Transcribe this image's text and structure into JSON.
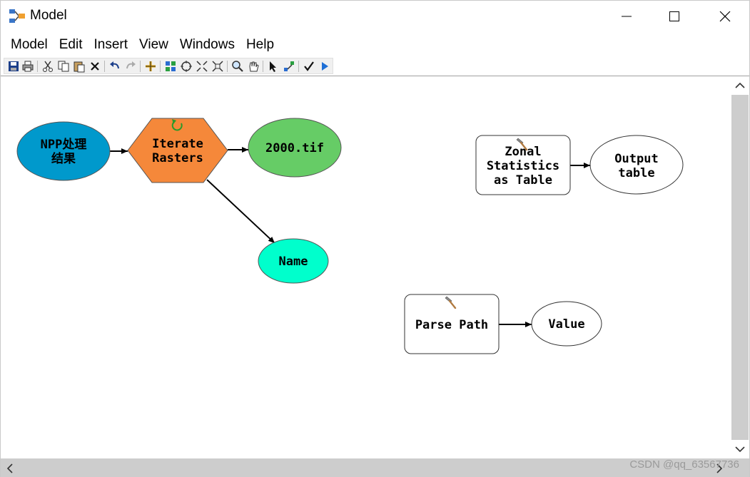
{
  "window": {
    "title": "Model",
    "controls": {
      "minimize": "minimize-icon",
      "maximize": "maximize-icon",
      "close": "close-icon"
    }
  },
  "menu": [
    "Model",
    "Edit",
    "Insert",
    "View",
    "Windows",
    "Help"
  ],
  "toolbar": {
    "buttons": [
      "save-icon",
      "print-icon",
      "cut-icon",
      "copy-icon",
      "paste-icon",
      "delete-icon",
      "undo-icon",
      "redo-icon",
      "add-data-icon",
      "auto-layout-icon",
      "full-extent-icon",
      "zoom-in-fixed-icon",
      "zoom-out-fixed-icon",
      "zoom-icon",
      "pan-icon",
      "select-icon",
      "connect-icon",
      "validate-icon",
      "run-icon"
    ]
  },
  "diagram": {
    "colors": {
      "input_data": "#0099cc",
      "iterator": "#f5883a",
      "output_data": "#66cc66",
      "variable": "#00ffcc",
      "empty": "#ffffff"
    },
    "nodes": {
      "npp_results": "NPP处理\n结果",
      "iterate_rasters": "Iterate\nRasters",
      "raster_2000": "2000.tif",
      "name": "Name",
      "zonal_stats": "Zonal\nStatistics\nas Table",
      "output_table": "Output\ntable",
      "parse_path": "Parse Path",
      "value": "Value"
    }
  },
  "watermark": "CSDN @qq_63567736"
}
